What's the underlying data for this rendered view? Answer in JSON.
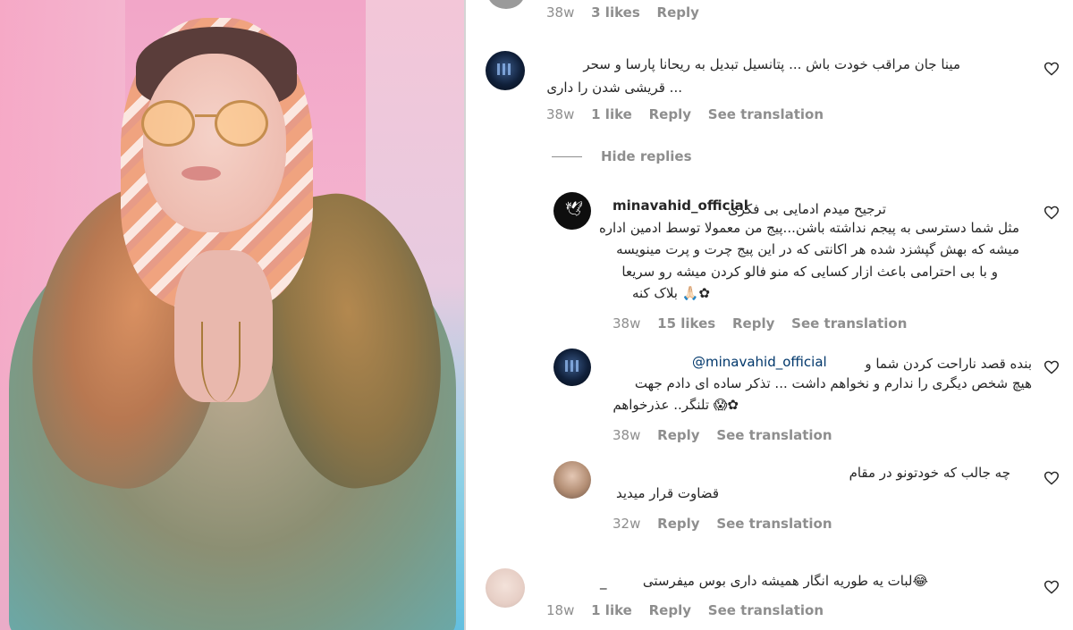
{
  "comments": [
    {
      "id": "c0",
      "text_lines": [],
      "time": "38w",
      "likes": "3 likes",
      "reply": "Reply",
      "see_translation": ""
    },
    {
      "id": "c1",
      "text_lines": [
        "مینا جان مراقب خودت باش ... پتانسیل تبدیل به ریحانا پارسا و سحر",
        "... قریشی شدن را داری"
      ],
      "time": "38w",
      "likes": "1 like",
      "reply": "Reply",
      "see_translation": "See translation"
    },
    {
      "id": "c2",
      "username": "minavahid_official",
      "text_lines": [
        "ترجیح میدم ادمایی بی فکری",
        "مثل شما دسترسی به پیجم نداشته باشن...پیج من معمولا توسط ادمین اداره",
        "میشه که بهش گپشزد شده هر اکانتی که در این پیج چرت و پرت مینویسه",
        "و با بی احترامی باعث ازار کسایی که منو فالو کردن میشه رو سریعا",
        "✿🙏🏻 بلاک کنه"
      ],
      "time": "38w",
      "likes": "15 likes",
      "reply": "Reply",
      "see_translation": "See translation"
    },
    {
      "id": "c3",
      "mention": "@minavahid_official",
      "text_lines": [
        "بنده قصد ناراحت کردن شما و",
        "هیچ شخص دیگری را ندارم و نخواهم داشت ... تذکر ساده ای دادم جهت",
        "✿😱 تلنگر.. عذرخواهم"
      ],
      "time": "38w",
      "reply": "Reply",
      "see_translation": "See translation"
    },
    {
      "id": "c4",
      "text_lines": [
        "چه جالب که خودتونو در مقام",
        "قضاوت قرار میدید"
      ],
      "time": "32w",
      "reply": "Reply",
      "see_translation": "See translation"
    },
    {
      "id": "c5",
      "text_lines": [
        "😂لبات یه طوریه انگار همیشه داری بوس میفرستی",
        "_"
      ],
      "time": "18w",
      "likes": "1 like",
      "reply": "Reply",
      "see_translation": "See translation"
    }
  ],
  "hide_replies": "Hide replies",
  "icons": {
    "heart": "heart-outline-icon",
    "bird": "bird-icon"
  }
}
